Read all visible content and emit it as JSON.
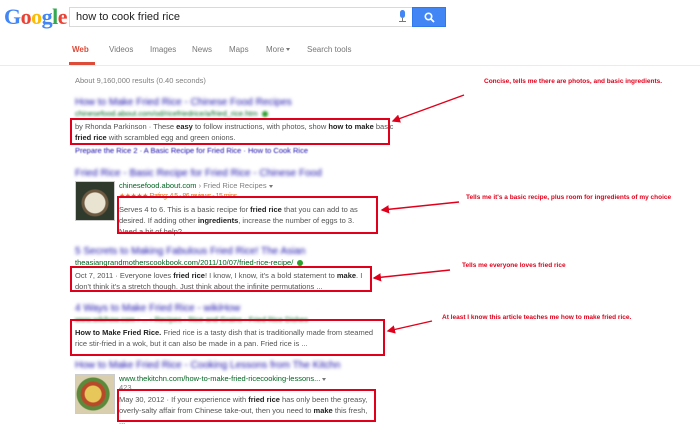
{
  "header": {
    "logo": [
      "G",
      "o",
      "o",
      "g",
      "l",
      "e"
    ],
    "query": "how to cook fried rice"
  },
  "tabs": [
    {
      "label": "Web",
      "active": true
    },
    {
      "label": "Videos"
    },
    {
      "label": "Images"
    },
    {
      "label": "News"
    },
    {
      "label": "Maps"
    },
    {
      "label": "More"
    },
    {
      "label": "Search tools"
    }
  ],
  "stats": "About 9,160,000 results (0.40 seconds)",
  "results": [
    {
      "title": "How to Make Fried Rice - Chinese Food Recipes",
      "url": "chinesefood.about.com/od/ricefriedrice/a/fried_rice.htm",
      "snippet_html": "by Rhonda Parkinson · These <b>easy</b> to follow instructions, with photos, show <b>how to make</b> basic <b>fried rice</b> with scrambled egg and green onions.",
      "extra": "Prepare the Rice 2 · A Basic Recipe for Fried Rice · How to Cook Rice"
    },
    {
      "title": "Fried Rice - Basic Recipe for Fried Rice - Chinese Food",
      "url": "chinesefood.about.com",
      "breadcrumb": "› Fried Rice Recipes",
      "rating": "★★★★★ Rating: 4.5 - 86 reviews - 15 mins",
      "snippet_html": "Serves 4 to 6. This is a basic recipe for <b>fried rice</b> that you can add to as desired. If adding other <b>ingredients</b>, increase the number of eggs to 3. Need a bit of help?"
    },
    {
      "title": "5 Secrets to Making Fabulous Fried Rice! The Asian",
      "url": "theasiangrandmotherscookbook.com/2011/10/07/fried-rice-recipe/",
      "snippet_html": "Oct 7, 2011 · Everyone loves <b>fried rice</b>! I know, I know, it's a bold statement to <b>make</b>. I don't think it's a stretch though. Just think about the infinite permutations ..."
    },
    {
      "title": "4 Ways to Make Fried Rice - wikiHow",
      "url": "www.wikihow.com › ... › Recipes › Rice and Grains › Fried Rice Dishes",
      "snippet_html": "<b>How to Make Fried Rice.</b> Fried rice is a tasty dish that is traditionally made from steamed rice stir-fried in a wok, but it can also be made in a pan. Fried rice is ..."
    },
    {
      "title": "How to Make Fried Rice - Cooking Lessons from The Kitchn",
      "url": "www.thekitchn.com/how-to-make-fried-ricecooking-lessons...",
      "meta": "423 ...",
      "snippet_html": "May 30, 2012 · If your experience with <b>fried rice</b> has only been the greasy, overly-salty affair from Chinese take-out, then you need to <b>make</b> this fresh, ..."
    }
  ],
  "annotations": [
    "Concise, tells me there are photos, and basic ingredients.",
    "Tells me it's a basic recipe, plus room for ingredients of my choice",
    "Tells me everyone loves fried rice",
    "At least I know this article teaches me how to make fried rice."
  ],
  "colors": {
    "highlight": "#e0001b",
    "link": "#1a0dab",
    "url": "#006621",
    "active_tab": "#dd4b39"
  }
}
